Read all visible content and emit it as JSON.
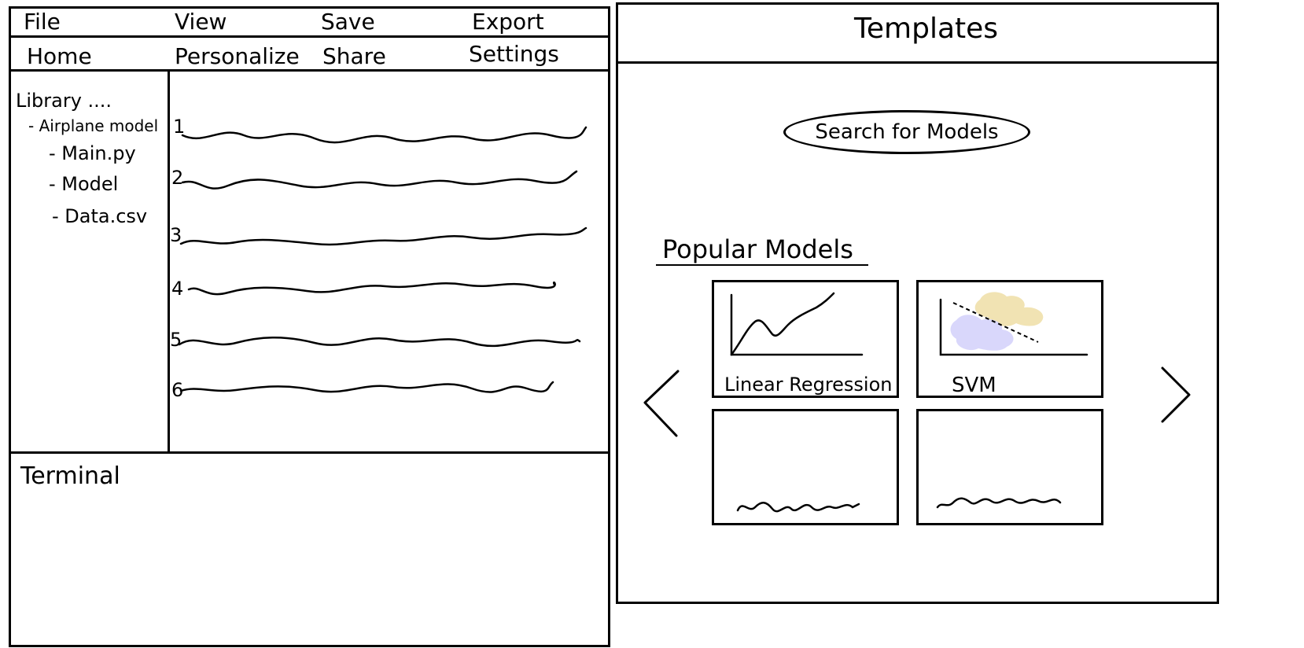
{
  "editor": {
    "menubar": {
      "items": [
        "File",
        "View",
        "Save",
        "Export"
      ]
    },
    "toolbar": {
      "items": [
        "Home",
        "Personalize",
        "Share",
        "Settings"
      ]
    },
    "sidebar": {
      "title": "Library ....",
      "items": [
        {
          "label": "- Airplane model"
        },
        {
          "label": "- Main.py"
        },
        {
          "label": "- Model"
        },
        {
          "label": "- Data.csv"
        }
      ]
    },
    "code": {
      "line_numbers": [
        "1",
        "2",
        "3",
        "4",
        "5",
        "6"
      ]
    },
    "terminal": {
      "title": "Terminal"
    }
  },
  "templates": {
    "title": "Templates",
    "search": {
      "placeholder": "Search for Models"
    },
    "popular": {
      "heading": "Popular Models",
      "cards": [
        {
          "label": "Linear Regression",
          "icon": "line-chart-icon"
        },
        {
          "label": "SVM",
          "icon": "scatter-clusters-icon"
        },
        {
          "label": "",
          "icon": "scribble-icon"
        },
        {
          "label": "",
          "icon": "scribble-icon"
        }
      ]
    },
    "nav": {
      "prev_icon": "chevron-left-icon",
      "next_icon": "chevron-right-icon"
    },
    "colors": {
      "cluster_yellow": "#f1e3b3",
      "cluster_purple": "#d9d7fb"
    }
  }
}
